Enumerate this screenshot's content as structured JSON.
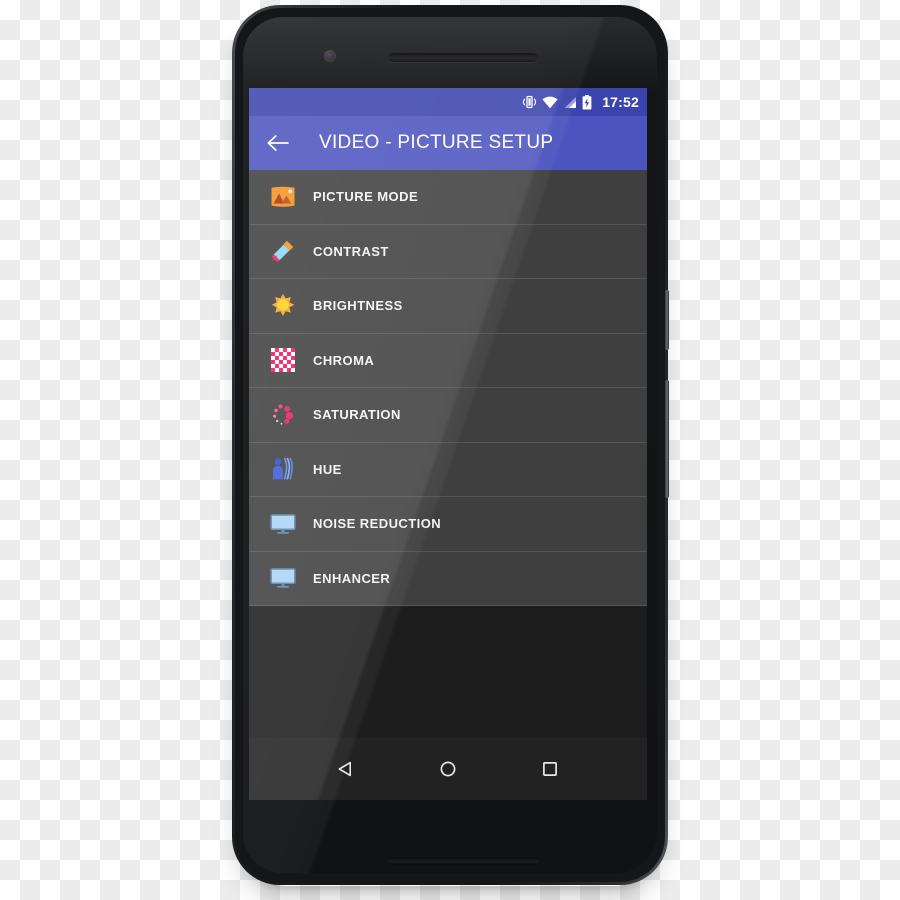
{
  "device": {
    "name": "android-smartphone",
    "front_camera": "front-camera",
    "earpiece": "earpiece-speaker",
    "power_button": "power-button",
    "volume_button": "volume-rocker"
  },
  "status_bar": {
    "clock": "17:52",
    "background_color": "#3b44ad",
    "icons": [
      {
        "name": "vibrate-icon",
        "label": "vibrate"
      },
      {
        "name": "wifi-icon",
        "label": "wifi"
      },
      {
        "name": "signal-icon",
        "label": "cellular-signal"
      },
      {
        "name": "battery-charging-icon",
        "label": "battery charging"
      }
    ]
  },
  "app_bar": {
    "title": "VIDEO - PICTURE SETUP",
    "back_label": "Back",
    "background_color": "#4c54bf",
    "text_color": "#ffffff"
  },
  "list": {
    "background_color": "#3f3f3f",
    "divider_color": "#565656",
    "items": [
      {
        "label": "PICTURE MODE",
        "icon": "picture-image-icon",
        "accent": "#f7931e"
      },
      {
        "label": "CONTRAST",
        "icon": "eyedropper-icon",
        "accent": "#f7931e"
      },
      {
        "label": "BRIGHTNESS",
        "icon": "sun-icon",
        "accent": "#ffd521"
      },
      {
        "label": "CHROMA",
        "icon": "checkerboard-icon",
        "accent": "#f5175e"
      },
      {
        "label": "SATURATION",
        "icon": "color-dots-icon",
        "accent": "#ec1e63"
      },
      {
        "label": "HUE",
        "icon": "person-waves-icon",
        "accent": "#3b5bdb"
      },
      {
        "label": "NOISE REDUCTION",
        "icon": "monitor-icon",
        "accent": "#aad4f5"
      },
      {
        "label": "ENHANCER",
        "icon": "monitor-icon",
        "accent": "#aad4f5"
      }
    ]
  },
  "nav_bar": {
    "background_color": "#222223",
    "buttons": [
      {
        "name": "nav-back-button",
        "label": "Back"
      },
      {
        "name": "nav-home-button",
        "label": "Home"
      },
      {
        "name": "nav-recents-button",
        "label": "Recents"
      }
    ]
  }
}
